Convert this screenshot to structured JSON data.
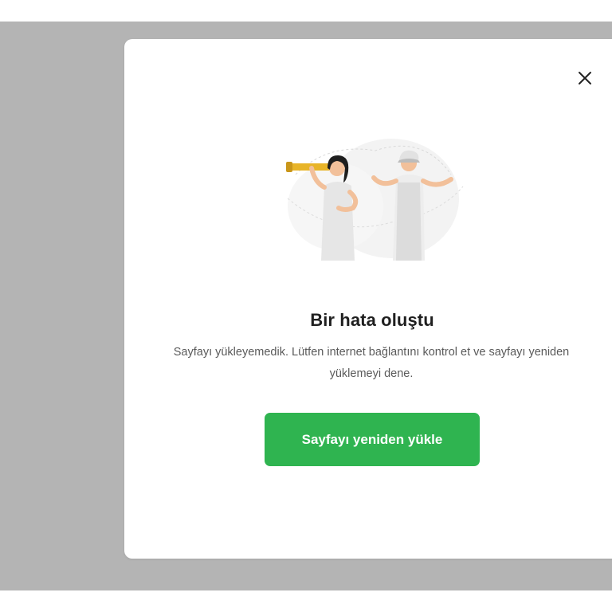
{
  "dialog": {
    "title": "Bir hata oluştu",
    "message": "Sayfayı yükleyemedik. Lütfen internet bağlantını kontrol et ve sayfayı yeniden yüklemeyi dene.",
    "reload_label": "Sayfayı yeniden yükle",
    "close_icon": "close-icon",
    "illustration_icon": "error-illustration"
  },
  "colors": {
    "backdrop": "#b4b4b4",
    "modal": "#ffffff",
    "primary_button": "#2fb450",
    "title_text": "#1f1f1f",
    "body_text": "#5a5a5a"
  }
}
